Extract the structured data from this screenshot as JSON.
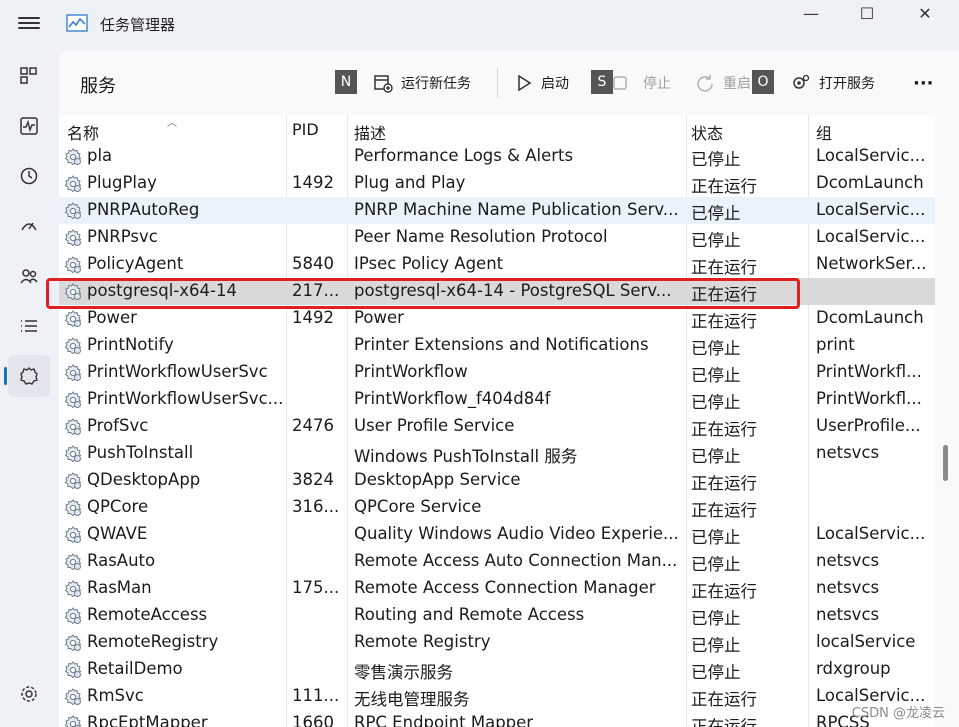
{
  "app": {
    "title": "任务管理器",
    "window_controls": {
      "minimize": "—",
      "maximize": "☐",
      "close": "✕"
    }
  },
  "nav": [
    {
      "icon": "processes-icon"
    },
    {
      "icon": "performance-icon"
    },
    {
      "icon": "app-history-icon"
    },
    {
      "icon": "startup-apps-icon"
    },
    {
      "icon": "users-icon"
    },
    {
      "icon": "details-icon"
    },
    {
      "icon": "services-icon",
      "active": true
    },
    {
      "icon": "settings-icon"
    }
  ],
  "toolbar": {
    "title": "服务",
    "badge_n": "N",
    "run_new_task": "运行新任务",
    "start": "启动",
    "badge_s": "S",
    "stop": "停止",
    "restart": "重启",
    "badge_o": "O",
    "open_services": "打开服务",
    "more": "···"
  },
  "columns": {
    "name": "名称",
    "pid": "PID",
    "desc": "描述",
    "status": "状态",
    "group": "组"
  },
  "rows": [
    {
      "name": "pla",
      "pid": "",
      "desc": "Performance Logs & Alerts",
      "status": "已停止",
      "group": "LocalServic..."
    },
    {
      "name": "PlugPlay",
      "pid": "1492",
      "desc": "Plug and Play",
      "status": "正在运行",
      "group": "DcomLaunch"
    },
    {
      "name": "PNRPAutoReg",
      "pid": "",
      "desc": "PNRP Machine Name Publication Serv...",
      "status": "已停止",
      "group": "LocalServic...",
      "alt": true
    },
    {
      "name": "PNRPsvc",
      "pid": "",
      "desc": "Peer Name Resolution Protocol",
      "status": "已停止",
      "group": "LocalServic..."
    },
    {
      "name": "PolicyAgent",
      "pid": "5840",
      "desc": "IPsec Policy Agent",
      "status": "正在运行",
      "group": "NetworkSer..."
    },
    {
      "name": "postgresql-x64-14",
      "pid": "217...",
      "desc": "postgresql-x64-14 - PostgreSQL Serv...",
      "status": "正在运行",
      "group": "",
      "selected": true
    },
    {
      "name": "Power",
      "pid": "1492",
      "desc": "Power",
      "status": "正在运行",
      "group": "DcomLaunch"
    },
    {
      "name": "PrintNotify",
      "pid": "",
      "desc": "Printer Extensions and Notifications",
      "status": "已停止",
      "group": "print"
    },
    {
      "name": "PrintWorkflowUserSvc",
      "pid": "",
      "desc": "PrintWorkflow",
      "status": "已停止",
      "group": "PrintWorkfl..."
    },
    {
      "name": "PrintWorkflowUserSvc...",
      "pid": "",
      "desc": "PrintWorkflow_f404d84f",
      "status": "已停止",
      "group": "PrintWorkfl..."
    },
    {
      "name": "ProfSvc",
      "pid": "2476",
      "desc": "User Profile Service",
      "status": "正在运行",
      "group": "UserProfile..."
    },
    {
      "name": "PushToInstall",
      "pid": "",
      "desc": "Windows PushToInstall 服务",
      "status": "已停止",
      "group": "netsvcs"
    },
    {
      "name": "QDesktopApp",
      "pid": "3824",
      "desc": "DesktopApp Service",
      "status": "正在运行",
      "group": ""
    },
    {
      "name": "QPCore",
      "pid": "316...",
      "desc": "QPCore Service",
      "status": "正在运行",
      "group": ""
    },
    {
      "name": "QWAVE",
      "pid": "",
      "desc": "Quality Windows Audio Video Experie...",
      "status": "已停止",
      "group": "LocalServic..."
    },
    {
      "name": "RasAuto",
      "pid": "",
      "desc": "Remote Access Auto Connection Man...",
      "status": "已停止",
      "group": "netsvcs"
    },
    {
      "name": "RasMan",
      "pid": "175...",
      "desc": "Remote Access Connection Manager",
      "status": "正在运行",
      "group": "netsvcs"
    },
    {
      "name": "RemoteAccess",
      "pid": "",
      "desc": "Routing and Remote Access",
      "status": "已停止",
      "group": "netsvcs"
    },
    {
      "name": "RemoteRegistry",
      "pid": "",
      "desc": "Remote Registry",
      "status": "已停止",
      "group": "localService"
    },
    {
      "name": "RetailDemo",
      "pid": "",
      "desc": "零售演示服务",
      "status": "已停止",
      "group": "rdxgroup"
    },
    {
      "name": "RmSvc",
      "pid": "111...",
      "desc": "无线电管理服务",
      "status": "正在运行",
      "group": "LocalServic..."
    },
    {
      "name": "RpcEptMapper",
      "pid": "1660",
      "desc": "RPC Endpoint Mapper",
      "status": "正在运行",
      "group": "RPCSS"
    }
  ],
  "watermark": "CSDN @龙凌云"
}
